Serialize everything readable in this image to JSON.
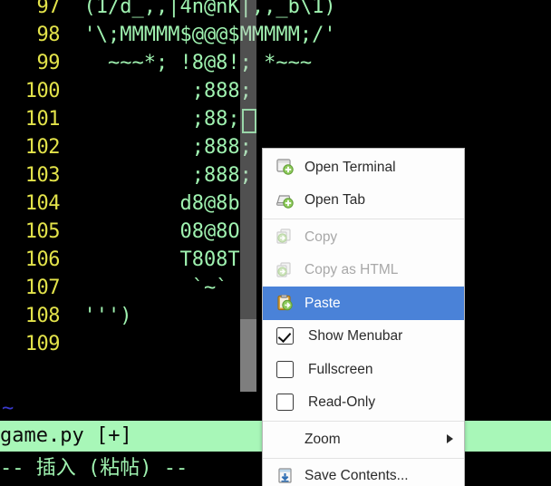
{
  "editor": {
    "app": "vim",
    "filename": "game.py",
    "lines": [
      {
        "num": "97",
        "text": "  (1/d_,,|4n@nK|,,_b\\1)"
      },
      {
        "num": "98",
        "text": "  '\\;MMMMM$@@@$MMMMM;/'"
      },
      {
        "num": "99",
        "text": "    ~~~*; !8@8!; *~~~"
      },
      {
        "num": "100",
        "text": "           ;888;"
      },
      {
        "num": "101",
        "text": "           ;88;"
      },
      {
        "num": "102",
        "text": "           ;888;"
      },
      {
        "num": "103",
        "text": "           ;888;"
      },
      {
        "num": "104",
        "text": "          d8@8b"
      },
      {
        "num": "105",
        "text": "          08@8O"
      },
      {
        "num": "106",
        "text": "          T808T"
      },
      {
        "num": "107",
        "text": "           `~`"
      },
      {
        "num": "108",
        "text": "  ''')"
      },
      {
        "num": "109",
        "text": ""
      }
    ],
    "empty_marker": "~",
    "statusline": "game.py [+]",
    "modeline": "-- 插入 (粘帖) --",
    "colors": {
      "background": "#000000",
      "line_number": "#e3e34a",
      "text": "#9ff2b0",
      "statusline_bg": "#a8f7b8",
      "cursor_border": "#7ee89a",
      "tilde": "#3a3ad0"
    }
  },
  "context_menu": {
    "items": [
      {
        "label": "Open Terminal",
        "icon": "terminal-add-icon",
        "type": "item",
        "state": "enabled"
      },
      {
        "label": "Open Tab",
        "icon": "tab-add-icon",
        "type": "item",
        "state": "enabled"
      },
      {
        "type": "separator"
      },
      {
        "label": "Copy",
        "icon": "copy-icon",
        "type": "item",
        "state": "disabled"
      },
      {
        "label": "Copy as HTML",
        "icon": "copy-html-icon",
        "type": "item",
        "state": "disabled"
      },
      {
        "label": "Paste",
        "icon": "paste-icon",
        "type": "item",
        "state": "selected"
      },
      {
        "label": "Show Menubar",
        "icon": "checkbox-checked",
        "type": "checkbox",
        "checked": true
      },
      {
        "label": "Fullscreen",
        "icon": "checkbox-unchecked",
        "type": "checkbox",
        "checked": false
      },
      {
        "label": "Read-Only",
        "icon": "checkbox-unchecked",
        "type": "checkbox",
        "checked": false
      },
      {
        "type": "separator"
      },
      {
        "label": "Zoom",
        "icon": "submenu-arrow-icon",
        "type": "submenu",
        "state": "enabled"
      },
      {
        "type": "separator"
      },
      {
        "label": "Save Contents...",
        "icon": "save-icon",
        "type": "item",
        "state": "enabled"
      }
    ],
    "colors": {
      "background": "#fdfdfd",
      "highlight": "#4a82d8",
      "text": "#2b2b2b",
      "disabled_text": "#a8a8a8",
      "separator": "#e2e2e2"
    }
  }
}
